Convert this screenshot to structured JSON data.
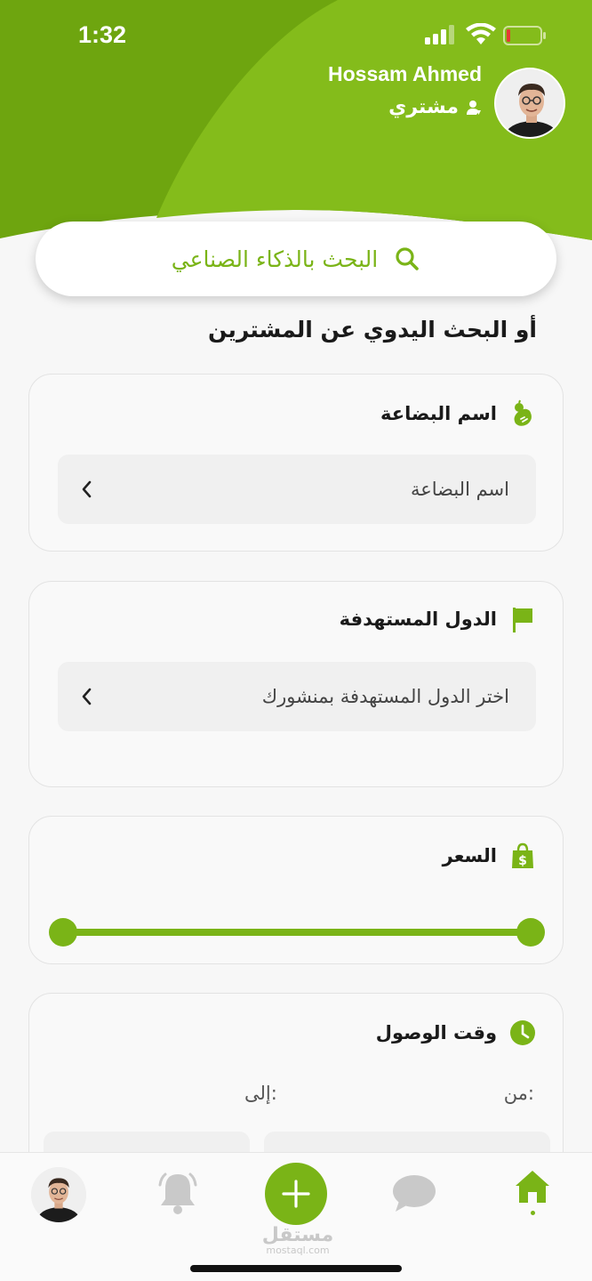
{
  "status_bar": {
    "time": "1:32"
  },
  "colors": {
    "primary": "#7ab417",
    "primary_dark": "#6ea50f",
    "hero_light": "#8cc21f"
  },
  "profile": {
    "name": "Hossam Ahmed",
    "role": "مشتري",
    "role_icon": "user-icon",
    "avatar": "avatar"
  },
  "ai_search": {
    "label": "البحث بالذكاء الصناعي",
    "icon": "search-icon"
  },
  "manual_search": {
    "title": "أو البحث اليدوي عن المشترين"
  },
  "goods_card": {
    "label": "اسم البضاعة",
    "icon": "produce-icon",
    "field_placeholder": "اسم البضاعة"
  },
  "countries_card": {
    "label": "الدول المستهدفة",
    "icon": "flag-icon",
    "field_placeholder": "اختر الدول المستهدفة بمنشورك"
  },
  "price_card": {
    "label": "السعر",
    "icon": "price-bag-icon",
    "slider_min_fraction": 0,
    "slider_max_fraction": 1
  },
  "arrival_card": {
    "label": "وقت الوصول",
    "icon": "clock-icon",
    "from_label": "من:",
    "to_label": "إلى:"
  },
  "bottom_nav": {
    "items": [
      "profile-avatar",
      "bell-icon",
      "add-icon",
      "chat-icon",
      "home-icon"
    ],
    "active": "home-icon"
  },
  "watermark": {
    "ar": "مستقل",
    "en": "mostaql.com"
  }
}
